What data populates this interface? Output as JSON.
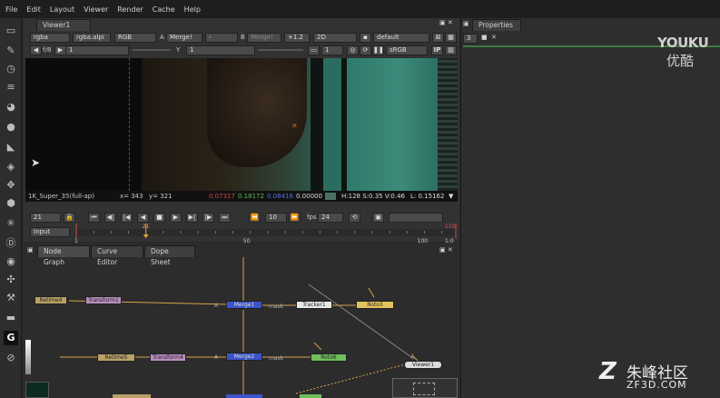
{
  "menu": [
    "File",
    "Edit",
    "Layout",
    "Viewer",
    "Render",
    "Cache",
    "Help"
  ],
  "viewer": {
    "tab": "Viewer1",
    "channels": "rgba",
    "alpha": "rgba.alpi",
    "rgb": "RGB",
    "a_label": "A",
    "a_input": "Merge!",
    "a_op": "-",
    "b_label": "B",
    "b_input": "Merge!",
    "gain": "+1.2",
    "mode": "2D",
    "lut": "default",
    "fstop": "f/8",
    "fstop_val": "1",
    "y_label": "Y",
    "y_val": "1",
    "proxy": "1",
    "colorspace": "sRGB",
    "format": "1K_Super_35(full-ap)",
    "x_info": "x= 343",
    "y_info": "y= 321",
    "pix_r": "0.07317",
    "pix_g": "0.18172",
    "pix_b": "0.08416",
    "pix_a": "0.00000",
    "hsv": "H:128 S:0.35 V:0.46",
    "lum": "L: 0.15162",
    "ip": "IP"
  },
  "timeline": {
    "frame": "21",
    "increment": "10",
    "fps_label": "fps",
    "fps": "24",
    "range": "Input",
    "ticks": [
      "1",
      "21",
      "50",
      "100",
      "110"
    ],
    "current_frame": 21,
    "first": 1,
    "last": 110,
    "markers": {
      "in": "1",
      "out": "1:0"
    }
  },
  "nodegraph": {
    "tabs": [
      "Node Graph",
      "Curve Editor",
      "Dope Sheet"
    ],
    "nodes": [
      {
        "name": "Retime4",
        "color": "#b8a067"
      },
      {
        "name": "Transform1",
        "color": "#b88dbf"
      },
      {
        "name": "Tracker1",
        "color": "#e8e8e8"
      },
      {
        "name": "Roto3",
        "color": "#e3c35c"
      },
      {
        "name": "Retime5",
        "color": "#b8a067"
      },
      {
        "name": "Transform4",
        "color": "#b88dbf"
      },
      {
        "name": "Merge1",
        "color": "#3a53c9"
      },
      {
        "name": "Merge2",
        "color": "#3a53c9"
      },
      {
        "name": "Roto6",
        "color": "#6fbf5c"
      },
      {
        "name": "Viewer1",
        "color": "#dcdcdc"
      }
    ],
    "mask1": "mask",
    "mask2": "mask",
    "a1": "A",
    "a2": "A",
    "viewer_input": "2"
  },
  "properties": {
    "tab": "Properties",
    "count": "3"
  },
  "watermark": {
    "top": "YOUKU",
    "top_sub": "优酷",
    "bottom": "朱峰社区",
    "bottom_sub": "ZF3D.COM"
  },
  "colors": {
    "accent": "#e8a040",
    "merge": "#3a53c9",
    "pix_r": "#d04040",
    "pix_g": "#50c050",
    "pix_b": "#5070e0"
  }
}
